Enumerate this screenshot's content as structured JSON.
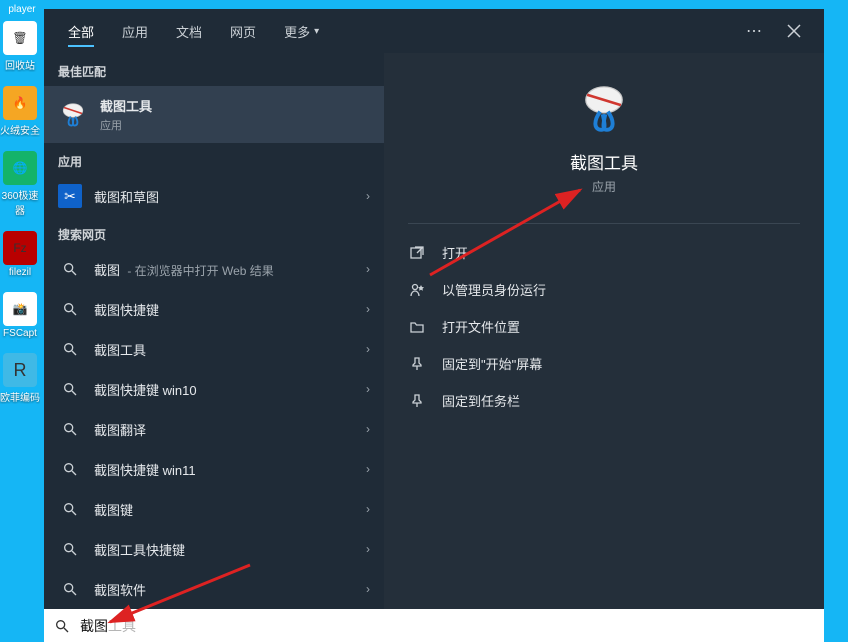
{
  "desktop": {
    "player_label": "player",
    "icons": [
      {
        "label": "回收站",
        "bg": "#ffffff",
        "glyph": "🗑"
      },
      {
        "label": "火绒安全",
        "bg": "#f5a623",
        "glyph": "🔥"
      },
      {
        "label": "360极速\n器",
        "bg": "#14b36a",
        "glyph": "🌐"
      },
      {
        "label": "filezil",
        "bg": "#b90000",
        "glyph": "Fz"
      },
      {
        "label": "FSCapt",
        "bg": "#ffffff",
        "glyph": "📸"
      },
      {
        "label": "欧菲编码",
        "bg": "#3fb9e6",
        "glyph": "R"
      }
    ]
  },
  "tabs": {
    "items": [
      "全部",
      "应用",
      "文档",
      "网页",
      "更多"
    ],
    "active_index": 0
  },
  "left": {
    "best_match": "最佳匹配",
    "primary": {
      "title": "截图工具",
      "subtitle": "应用"
    },
    "apps_header": "应用",
    "app_item": "截图和草图",
    "web_header": "搜索网页",
    "web_items": [
      {
        "text": "截图",
        "suffix": " - 在浏览器中打开 Web 结果"
      },
      {
        "text": "截图快捷键",
        "suffix": ""
      },
      {
        "text": "截图工具",
        "suffix": ""
      },
      {
        "text": "截图快捷键 win10",
        "suffix": ""
      },
      {
        "text": "截图翻译",
        "suffix": ""
      },
      {
        "text": "截图快捷键 win11",
        "suffix": ""
      },
      {
        "text": "截图键",
        "suffix": ""
      },
      {
        "text": "截图工具快捷键",
        "suffix": ""
      },
      {
        "text": "截图软件",
        "suffix": ""
      }
    ]
  },
  "detail": {
    "title": "截图工具",
    "subtitle": "应用",
    "actions": [
      {
        "icon": "open",
        "label": "打开"
      },
      {
        "icon": "admin",
        "label": "以管理员身份运行"
      },
      {
        "icon": "folder",
        "label": "打开文件位置"
      },
      {
        "icon": "pin-start",
        "label": "固定到\"开始\"屏幕"
      },
      {
        "icon": "pin-task",
        "label": "固定到任务栏"
      }
    ]
  },
  "search": {
    "typed": "截图",
    "completion": "工具"
  }
}
